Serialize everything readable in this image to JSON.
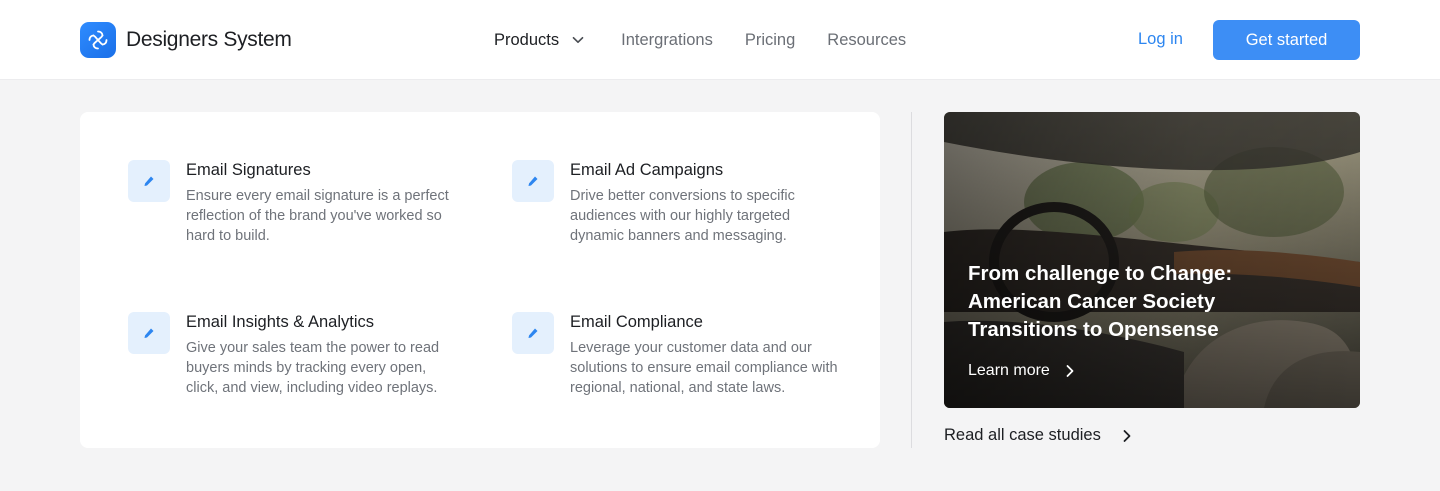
{
  "brand": {
    "name": "Designers System",
    "accent": "#3d8ef5",
    "icon": "swirl-logo-icon"
  },
  "nav": {
    "items": [
      {
        "label": "Products",
        "active": true,
        "dropdown": true
      },
      {
        "label": "Intergrations"
      },
      {
        "label": "Pricing"
      },
      {
        "label": "Resources"
      }
    ],
    "login": "Log in",
    "cta": "Get started"
  },
  "products": [
    {
      "title": "Email Signatures",
      "description": "Ensure every email signature is a perfect reflection of the brand you've worked so hard to build.",
      "icon": "pencil-icon"
    },
    {
      "title": "Email Ad Campaigns",
      "description": "Drive better conversions to specific audiences with our highly targeted dynamic banners and messaging.",
      "icon": "pencil-icon"
    },
    {
      "title": "Email Insights & Analytics",
      "description": "Give your sales team the power to read buyers minds by tracking every open, click, and view, including video replays.",
      "icon": "pencil-icon"
    },
    {
      "title": "Email Compliance",
      "description": "Leverage your customer data and our solutions to ensure email compliance with regional, national, and state laws.",
      "icon": "pencil-icon"
    }
  ],
  "case_study": {
    "title": "From challenge to Change: American Cancer Society Transitions to Opensense",
    "link": "Learn more",
    "image": "car-interior-photo"
  },
  "read_all": "Read all case studies"
}
